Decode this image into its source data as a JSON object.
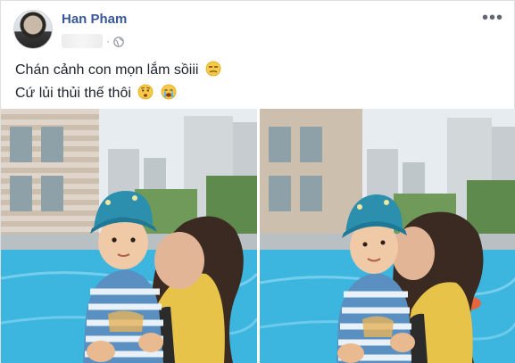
{
  "post": {
    "author": "Han Pham",
    "lines": [
      "Chán cảnh con mọn lắm sồiii",
      "Cứ lủi thủi thế thôi"
    ],
    "more_label": "•••"
  },
  "icons": {
    "avatar": "profile-photo",
    "privacy": "globe-icon",
    "more": "more-options-icon",
    "emoji_line1": "unamused-face",
    "emoji_line2a": "worried-face",
    "emoji_line2b": "crying-face"
  },
  "photos": [
    {
      "name": "photo-1"
    },
    {
      "name": "photo-2"
    }
  ]
}
